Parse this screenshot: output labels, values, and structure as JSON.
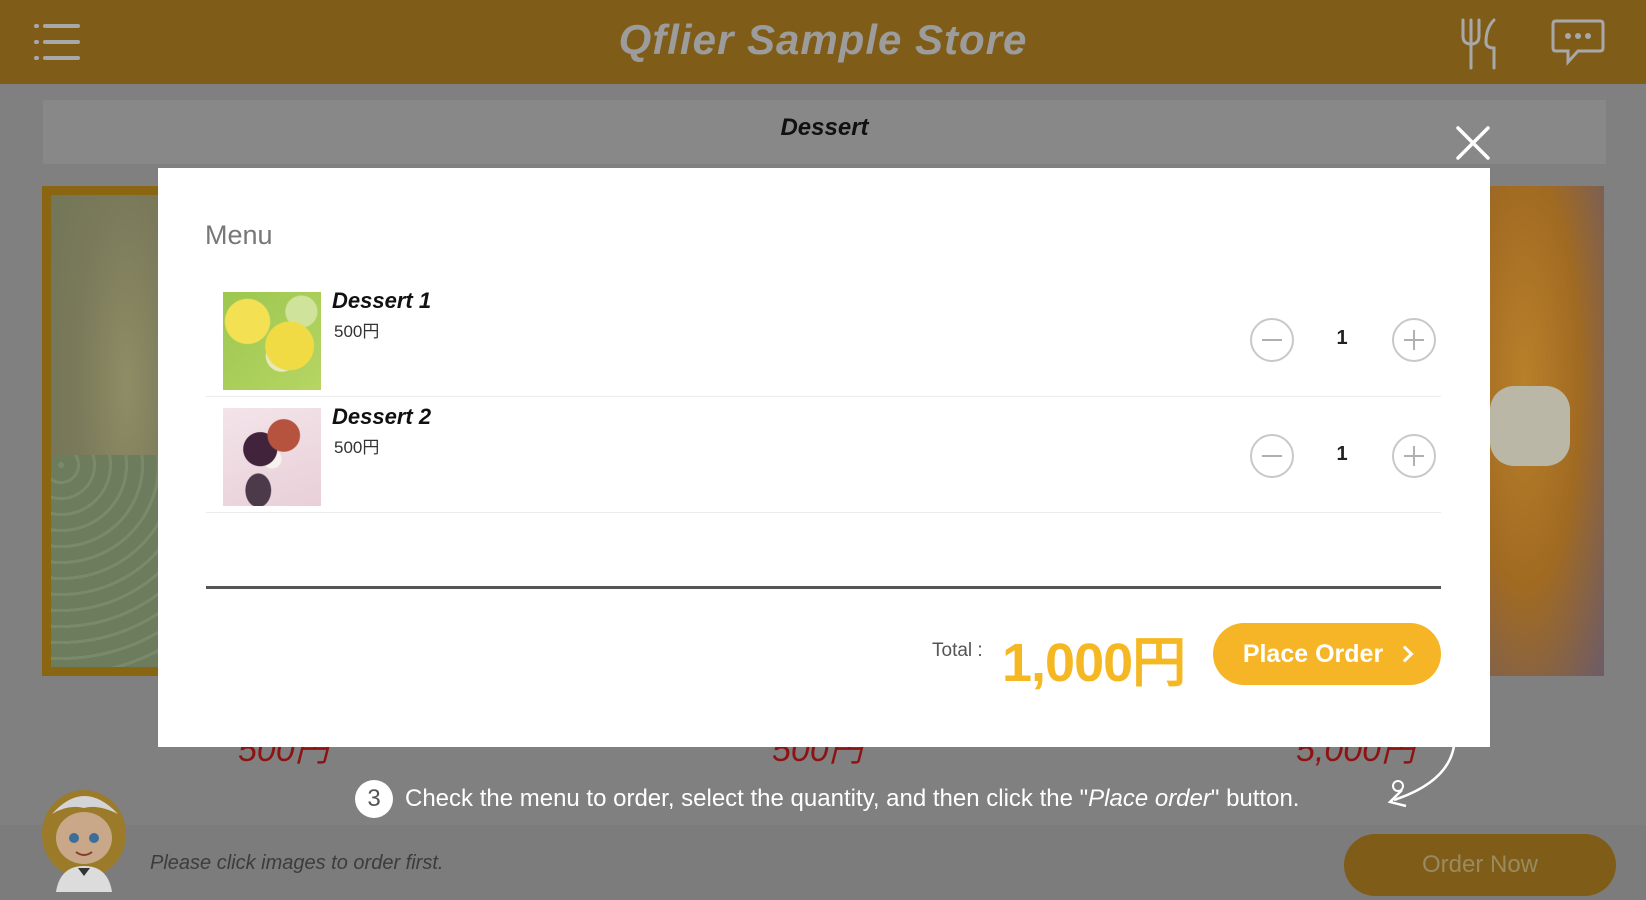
{
  "header": {
    "title": "Qflier Sample Store",
    "menu_icon": "hamburger-menu-icon",
    "cutlery_icon": "fork-knife-icon",
    "chat_icon": "chat-bubble-icon",
    "bar_color": "#7f5d18"
  },
  "page": {
    "category_title": "Dessert",
    "prices": [
      "500円",
      "500円",
      "5,000円"
    ],
    "instruction": {
      "step": "3",
      "text_before": "Check the menu to order, select the quantity, and then click the \"",
      "text_italic": "Place order",
      "text_after": "\" button."
    },
    "hint": "Please click images to order first.",
    "order_now_label": "Order Now"
  },
  "modal": {
    "title": "Menu",
    "close_icon": "close-icon",
    "items": [
      {
        "name": "Dessert 1",
        "price": "500円",
        "quantity": "1"
      },
      {
        "name": "Dessert 2",
        "price": "500円",
        "quantity": "1"
      }
    ],
    "total_label": "Total :",
    "total_value": "1,000円",
    "place_order_label": "Place Order",
    "accent_color": "#f6b526"
  }
}
